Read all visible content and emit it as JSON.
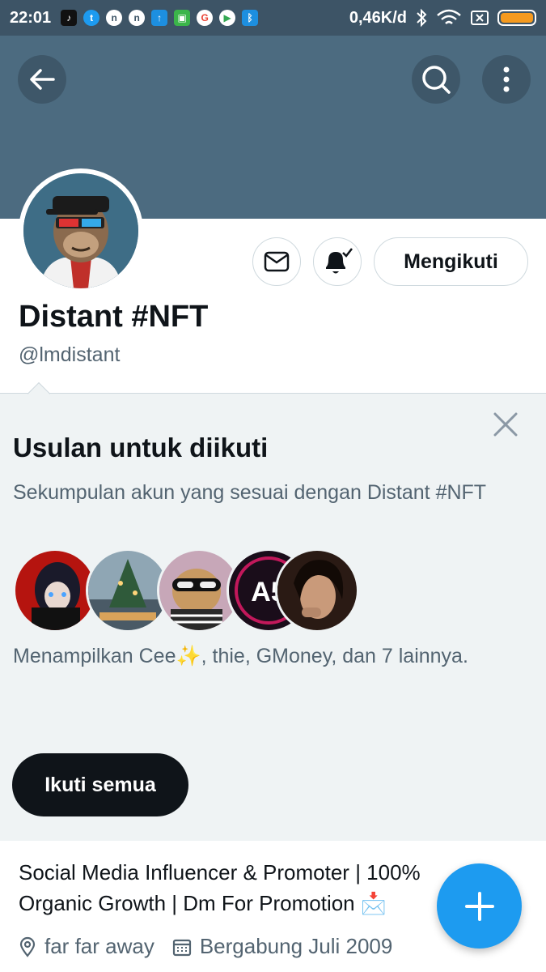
{
  "status_bar": {
    "time": "22:01",
    "speed": "0,46K/d",
    "app_icons": [
      "tiktok-icon",
      "twitter-icon",
      "n-app-icon",
      "n-app-icon",
      "upload-icon",
      "android-icon",
      "google-icon",
      "play-store-icon",
      "bluetooth-app-icon"
    ]
  },
  "header": {
    "back_icon": "arrow-left-icon",
    "search_icon": "search-icon",
    "more_icon": "more-vertical-icon"
  },
  "profile": {
    "display_name": "Distant #NFT",
    "handle": "@lmdistant",
    "follow_button": "Mengikuti",
    "message_icon": "envelope-icon",
    "notify_icon": "bell-check-icon"
  },
  "suggestions": {
    "title": "Usulan untuk diikuti",
    "description": "Sekumpulan akun yang sesuai dengan Distant #NFT",
    "showing_text": "Menampilkan Cee✨, thie, GMoney, dan 7 lainnya.",
    "follow_all_button": "Ikuti semua",
    "close_icon": "close-icon"
  },
  "bio": {
    "text": "Social Media Influencer & Promoter | 100% Organic Growth | Dm For Promotion 📩",
    "location": "far far away",
    "joined": "Bergabung Juli 2009"
  },
  "fab": {
    "icon": "plus-icon"
  },
  "colors": {
    "banner": "#4c6b80",
    "accent": "#1d9bf0",
    "panel": "#eff3f4"
  }
}
